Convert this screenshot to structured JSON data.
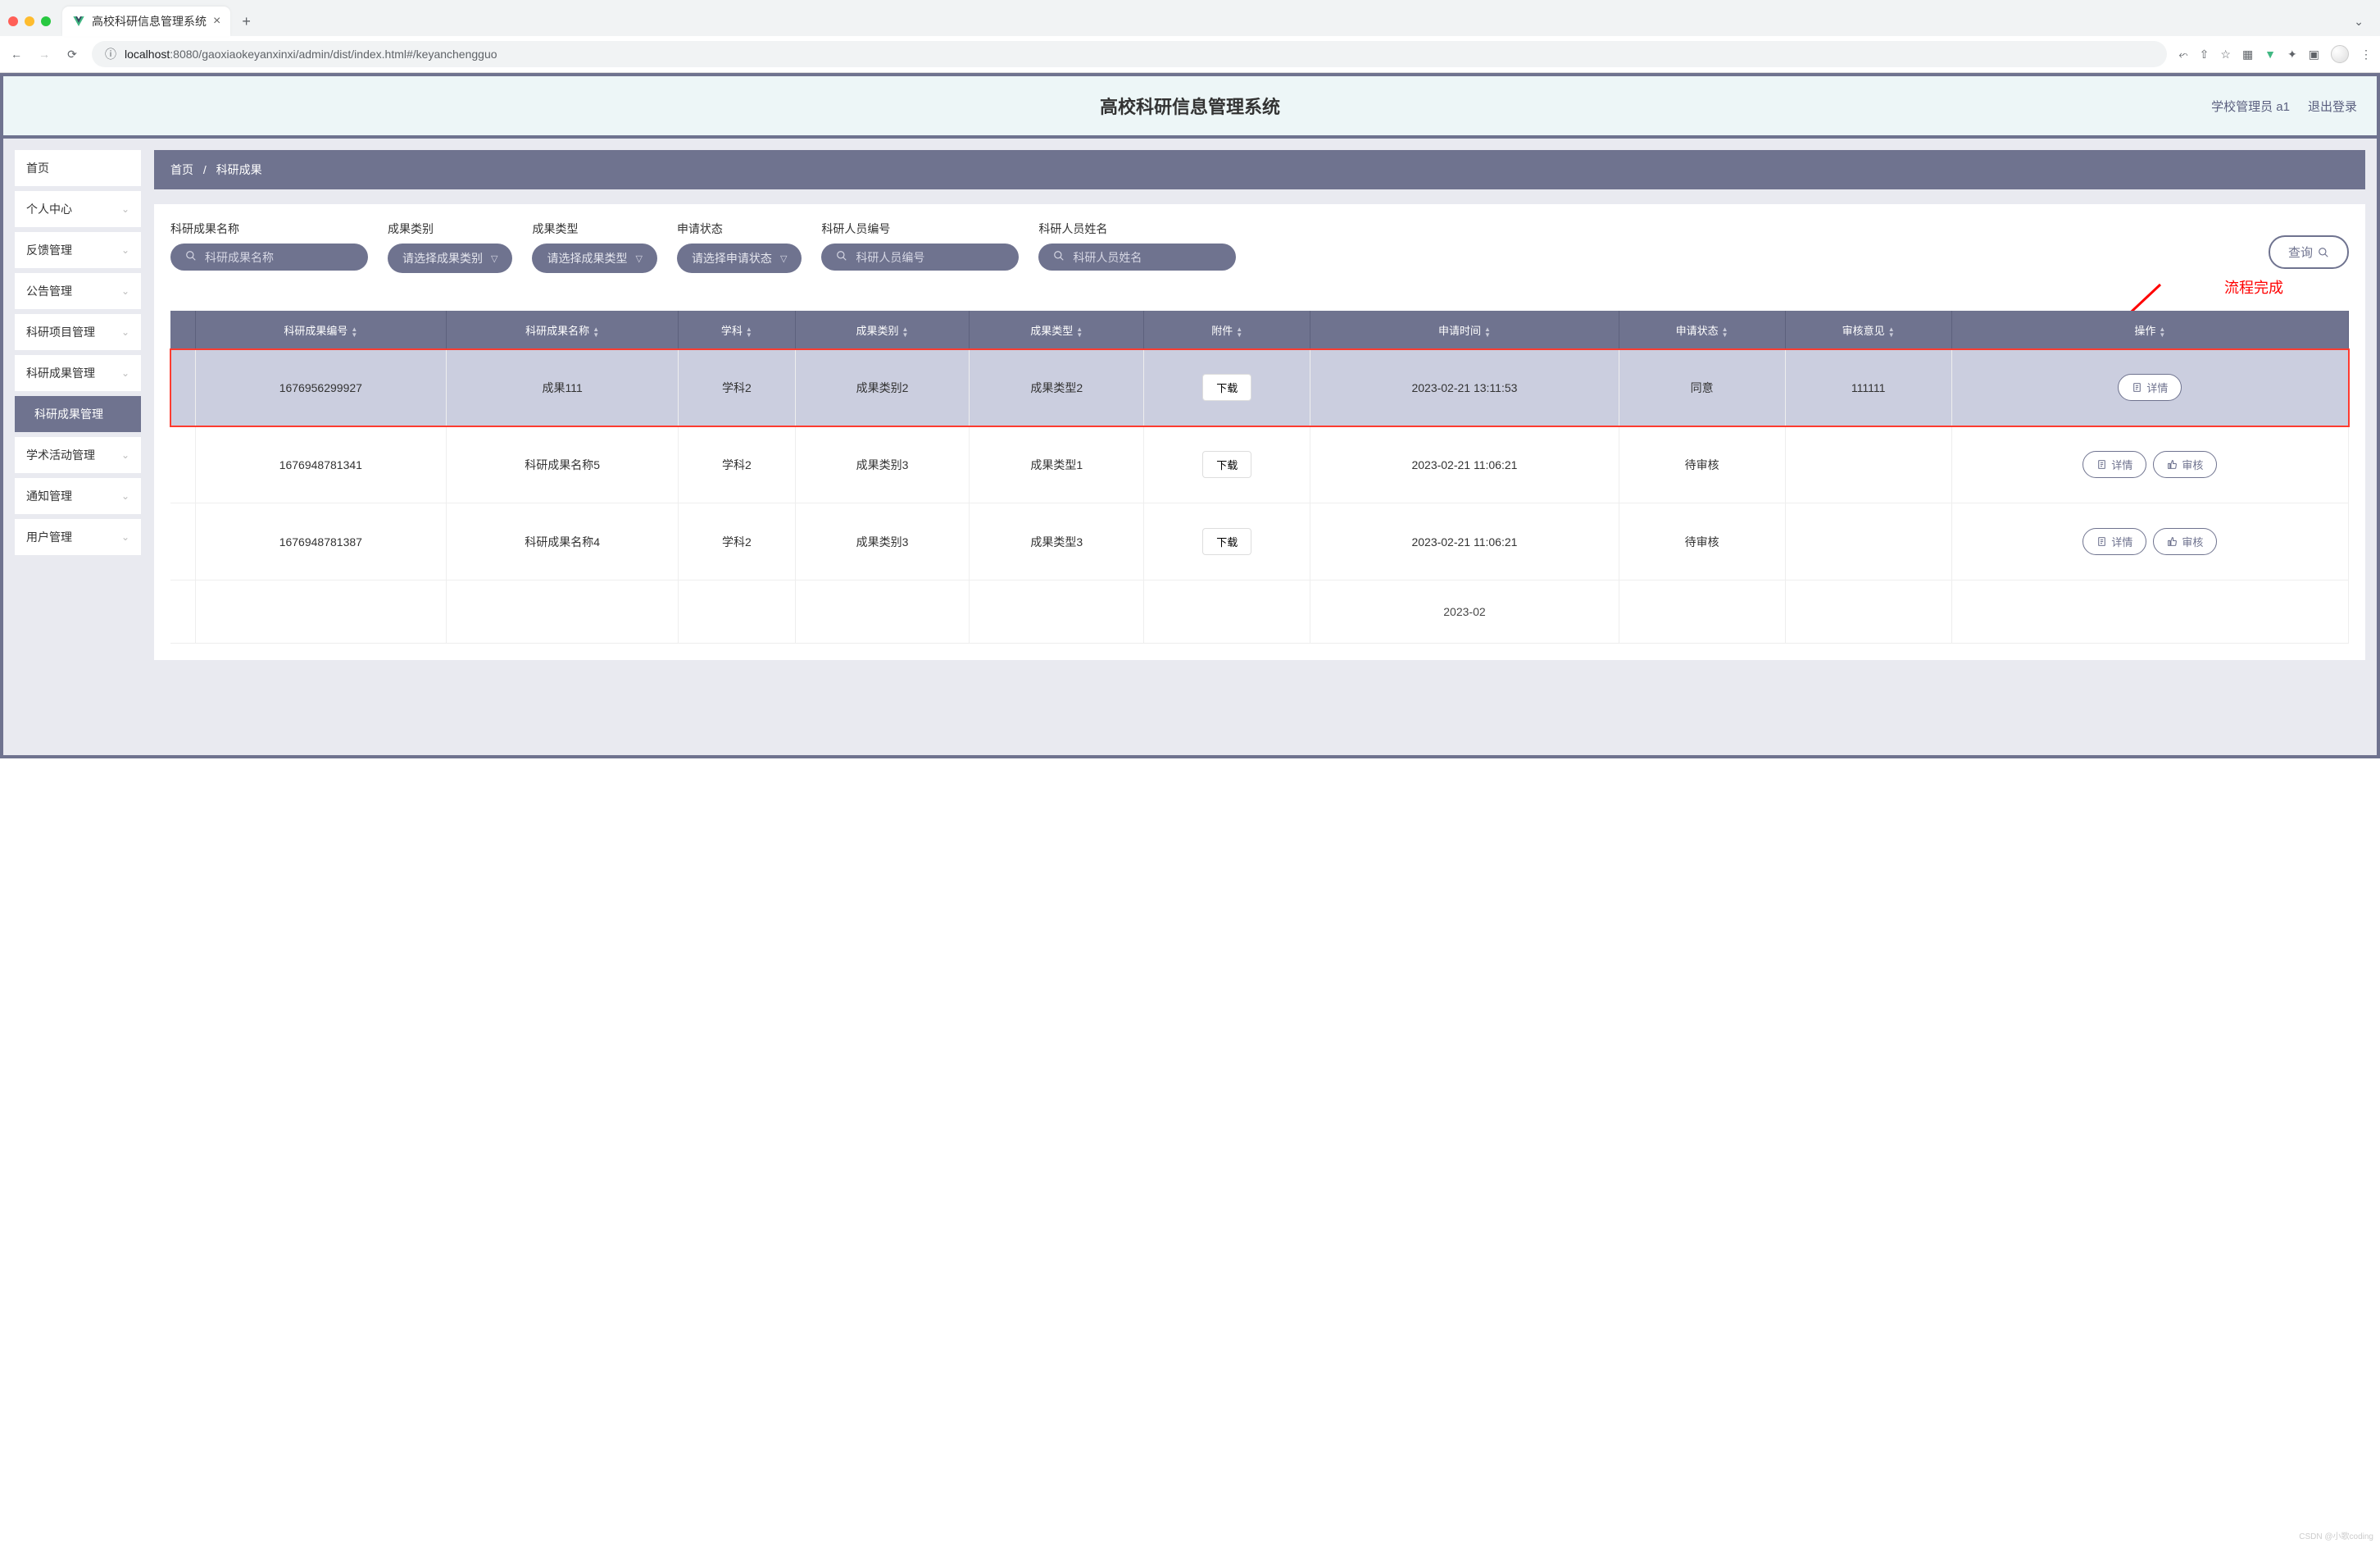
{
  "browser": {
    "tab_title": "高校科研信息管理系统",
    "url_host": "localhost",
    "url_path": ":8080/gaoxiaokeyanxinxi/admin/dist/index.html#/keyanchengguo"
  },
  "header": {
    "title": "高校科研信息管理系统",
    "user_role": "学校管理员 a1",
    "logout": "退出登录"
  },
  "sidebar": {
    "items": [
      {
        "label": "首页",
        "expandable": false
      },
      {
        "label": "个人中心",
        "expandable": true
      },
      {
        "label": "反馈管理",
        "expandable": true
      },
      {
        "label": "公告管理",
        "expandable": true
      },
      {
        "label": "科研项目管理",
        "expandable": true
      },
      {
        "label": "科研成果管理",
        "expandable": true
      },
      {
        "label": "科研成果管理",
        "expandable": false,
        "active": true
      },
      {
        "label": "学术活动管理",
        "expandable": true
      },
      {
        "label": "通知管理",
        "expandable": true
      },
      {
        "label": "用户管理",
        "expandable": true
      }
    ]
  },
  "breadcrumb": {
    "home": "首页",
    "current": "科研成果"
  },
  "filters": {
    "f0": {
      "label": "科研成果名称",
      "placeholder": "科研成果名称"
    },
    "f1": {
      "label": "成果类别",
      "placeholder": "请选择成果类别"
    },
    "f2": {
      "label": "成果类型",
      "placeholder": "请选择成果类型"
    },
    "f3": {
      "label": "申请状态",
      "placeholder": "请选择申请状态"
    },
    "f4": {
      "label": "科研人员编号",
      "placeholder": "科研人员编号"
    },
    "f5": {
      "label": "科研人员姓名",
      "placeholder": "科研人员姓名"
    },
    "query": "查询"
  },
  "annotation": {
    "text": "流程完成"
  },
  "table": {
    "headers": [
      "科研成果编号",
      "科研成果名称",
      "学科",
      "成果类别",
      "成果类型",
      "附件",
      "申请时间",
      "申请状态",
      "审核意见",
      "操作"
    ],
    "download_label": "下载",
    "detail_label": "详情",
    "audit_label": "审核",
    "rows": [
      {
        "id": "1676956299927",
        "name": "成果111",
        "subject": "学科2",
        "category": "成果类别2",
        "type": "成果类型2",
        "time": "2023-02-21 13:11:53",
        "status": "同意",
        "opinion": "111111",
        "actions": [
          "detail"
        ],
        "highlighted": true
      },
      {
        "id": "1676948781341",
        "name": "科研成果名称5",
        "subject": "学科2",
        "category": "成果类别3",
        "type": "成果类型1",
        "time": "2023-02-21 11:06:21",
        "status": "待审核",
        "opinion": "",
        "actions": [
          "detail",
          "audit"
        ]
      },
      {
        "id": "1676948781387",
        "name": "科研成果名称4",
        "subject": "学科2",
        "category": "成果类别3",
        "type": "成果类型3",
        "time": "2023-02-21 11:06:21",
        "status": "待审核",
        "opinion": "",
        "actions": [
          "detail",
          "audit"
        ]
      },
      {
        "id": "",
        "name": "",
        "subject": "",
        "category": "",
        "type": "",
        "time": "2023-02",
        "status": "",
        "opinion": "",
        "actions": [],
        "partial": true
      }
    ]
  },
  "watermark": "CSDN @小歌coding"
}
